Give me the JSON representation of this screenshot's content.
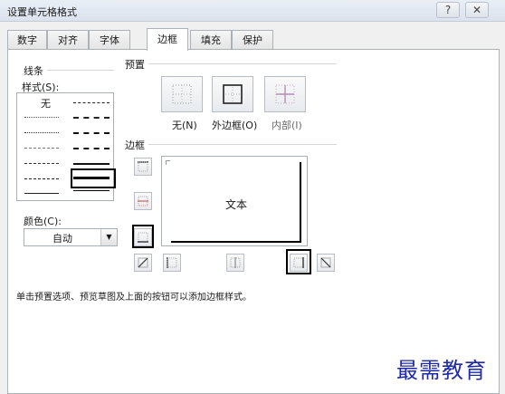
{
  "window": {
    "title": "设置单元格格式",
    "help_glyph": "?",
    "close_glyph": "✕"
  },
  "tabs": [
    {
      "label": "数字"
    },
    {
      "label": "对齐"
    },
    {
      "label": "字体"
    },
    {
      "label": "边框",
      "active": true
    },
    {
      "label": "填充"
    },
    {
      "label": "保护"
    }
  ],
  "line_group": {
    "title": "线条",
    "style_label": "样式(S):",
    "none_label": "无",
    "color_label": "颜色(C):",
    "color_value": "自动",
    "dropdown_glyph": "▼"
  },
  "preset_group": {
    "title": "预置",
    "none_label": "无(N)",
    "outline_label": "外边框(O)",
    "inside_label": "内部(I)"
  },
  "border_group": {
    "title": "边框",
    "preview_text": "文本"
  },
  "hint_text": "单击预置选项、预览草图及上面的按钮可以添加边框样式。",
  "watermark": "最需教育",
  "colors": {
    "panel_bg": "#ffffff",
    "dialog_bg": "#f0f0f0",
    "highlight": "#000000",
    "watermark": "#1f2aa8"
  }
}
